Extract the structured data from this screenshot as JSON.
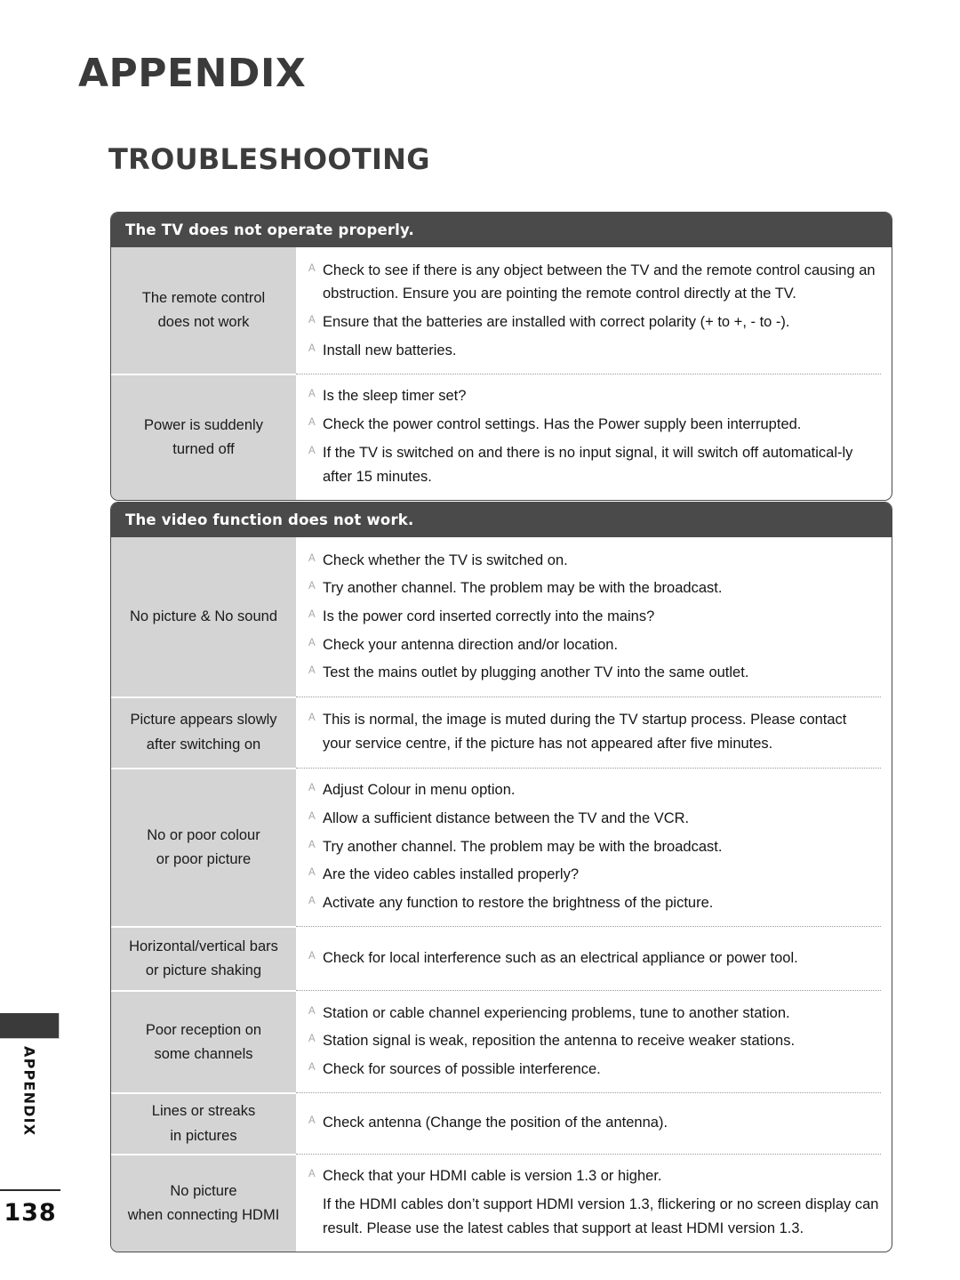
{
  "page": {
    "title": "APPENDIX",
    "section_title": "TROUBLESHOOTING",
    "side_label": "APPENDIX",
    "page_number": "138"
  },
  "colors": {
    "header_bar": "#4a4a4a",
    "label_cell": "#d4d4d4",
    "table_border": "#4a4a4a",
    "marker": "#a6a6a6"
  },
  "tables": [
    {
      "id": "tv-does-not-operate-properly",
      "header": "The TV does not operate properly.",
      "rows": [
        {
          "label": [
            "The remote control",
            "does not work"
          ],
          "solutions": [
            {
              "marker": "A",
              "text": "Check to see if there is any object between the TV and the remote control causing an obstruction. Ensure you are pointing the remote control directly at the TV."
            },
            {
              "marker": "A",
              "text": "Ensure that the batteries are installed with correct polarity (+ to +, - to -)."
            },
            {
              "marker": "A",
              "text": "Install new batteries."
            }
          ]
        },
        {
          "label": [
            "Power is suddenly",
            "turned off"
          ],
          "solutions": [
            {
              "marker": "A",
              "text": "Is the sleep timer set?"
            },
            {
              "marker": "A",
              "text": "Check the power control settings. Has the Power supply been interrupted."
            },
            {
              "marker": "A",
              "text": "If the TV is switched on and there is no input signal, it will switch off automatical-ly after 15 minutes."
            }
          ]
        }
      ]
    },
    {
      "id": "video-function-does-not-work",
      "header": "The video function does not work.",
      "rows": [
        {
          "label": [
            "No picture & No sound"
          ],
          "solutions": [
            {
              "marker": "A",
              "text": "Check whether the TV is switched on."
            },
            {
              "marker": "A",
              "text": "Try another channel. The problem may be with the broadcast."
            },
            {
              "marker": "A",
              "text": "Is the power cord inserted correctly into the mains?"
            },
            {
              "marker": "A",
              "text": "Check your antenna direction and/or location."
            },
            {
              "marker": "A",
              "text": "Test the mains outlet by plugging another TV into the same outlet."
            }
          ]
        },
        {
          "label": [
            "Picture appears slowly",
            "after switching on"
          ],
          "solutions": [
            {
              "marker": "A",
              "text": "This is normal, the image is muted during the TV startup process. Please contact your service centre, if the picture has not appeared after five minutes."
            }
          ]
        },
        {
          "label": [
            "No or poor colour",
            "or poor picture"
          ],
          "solutions": [
            {
              "marker": "A",
              "text": "Adjust Colour in menu option."
            },
            {
              "marker": "A",
              "text": "Allow a sufficient distance between the TV and the VCR."
            },
            {
              "marker": "A",
              "text": "Try another channel. The problem may be with the broadcast."
            },
            {
              "marker": "A",
              "text": "Are the video cables installed properly?"
            },
            {
              "marker": "A",
              "text": "Activate any function to restore the brightness of the picture."
            }
          ]
        },
        {
          "label": [
            "Horizontal/vertical bars",
            "or picture shaking"
          ],
          "solutions": [
            {
              "marker": "A",
              "text": "Check for local interference such as an electrical appliance or power tool."
            }
          ]
        },
        {
          "label": [
            "Poor reception on",
            "some channels"
          ],
          "solutions": [
            {
              "marker": "A",
              "text": "Station or cable channel experiencing problems, tune to another station."
            },
            {
              "marker": "A",
              "text": "Station signal is weak, reposition the antenna to receive weaker stations."
            },
            {
              "marker": "A",
              "text": "Check for sources of possible interference."
            }
          ]
        },
        {
          "label": [
            "Lines or streaks",
            "in pictures"
          ],
          "solutions": [
            {
              "marker": "A",
              "text": "Check antenna (Change the position of the antenna)."
            }
          ]
        },
        {
          "label": [
            "No picture",
            "when connecting HDMI"
          ],
          "solutions": [
            {
              "marker": "A",
              "text": "Check that your HDMI cable is version 1.3 or higher."
            },
            {
              "marker": "",
              "text": "If the HDMI cables don’t support HDMI version 1.3, flickering or no screen display can result. Please use the latest cables that support at least HDMI version 1.3."
            }
          ]
        }
      ]
    }
  ]
}
